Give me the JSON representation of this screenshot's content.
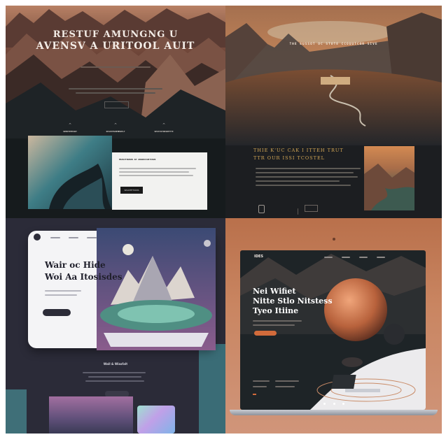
{
  "panels": {
    "top_left": {
      "hero_line1": "RESTUF AMUNGNG U",
      "hero_line2": "AVENSV A URITOOL AUIT",
      "cta_label": "",
      "features": [
        {
          "label": "SEENTEMTANT"
        },
        {
          "label": "SPASTESHEMMAPLT"
        },
        {
          "label": "SESTISTREAPPTTE"
        }
      ],
      "card_heading": "MASSITOUSON AE ANAOOCIUSTIOUS",
      "card_button": "SEANTETIONS"
    },
    "top_right": {
      "hero_caption": "THE EUSSOT OC STOTE CCOUUTCON SIVE",
      "heading_line1": "THIE K'UC CAK I ITTEH TRUT",
      "heading_line2": "TTR OUR ISSI TCOSTEL"
    },
    "bottom_left": {
      "headline_line1": "Wair oc Hide",
      "headline_line2": "Woi Aa Itosisdes",
      "tagline": "Wall & Wissfalt"
    },
    "bottom_right": {
      "logo": "IDES",
      "headline_line1": "Nei Wifiet",
      "headline_line2": "Nitte Stlo Nitstess",
      "headline_line3": "Tyeo Itiine"
    }
  }
}
